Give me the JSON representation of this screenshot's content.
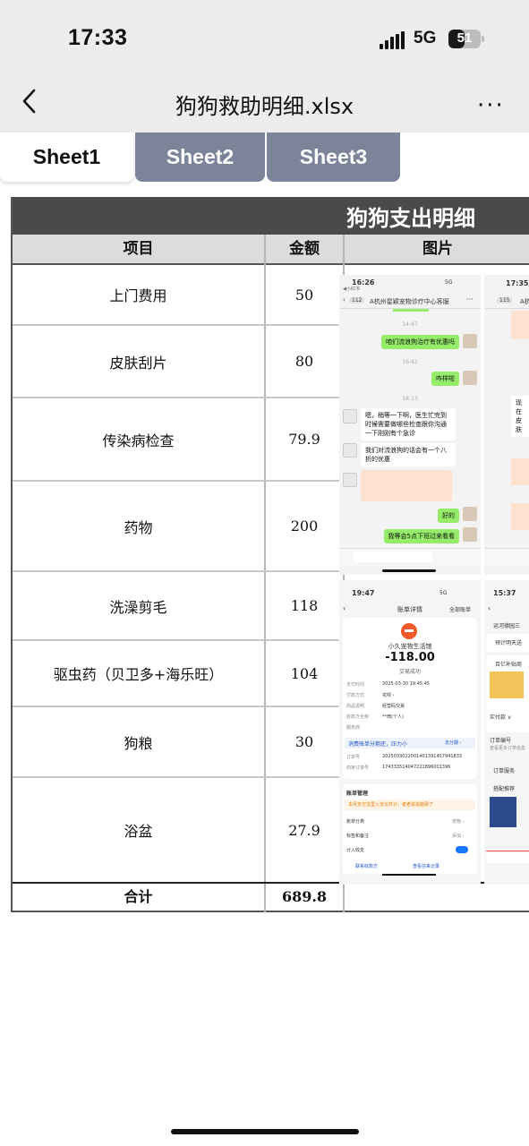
{
  "status": {
    "time": "17:33",
    "network": "5G",
    "battery": "51",
    "battery_level": 0.51
  },
  "nav": {
    "title": "狗狗救助明细.xlsx",
    "more": "···"
  },
  "tabs": [
    {
      "label": "Sheet1",
      "active": true
    },
    {
      "label": "Sheet2",
      "active": false
    },
    {
      "label": "Sheet3",
      "active": false
    }
  ],
  "sheet": {
    "title": "狗狗支出明细",
    "headers": {
      "item": "项目",
      "amount": "金额",
      "image": "图片"
    },
    "rows": [
      {
        "item": "上门费用",
        "amount": "50"
      },
      {
        "item": "皮肤刮片",
        "amount": "80"
      },
      {
        "item": "传染病检查",
        "amount": "79.9"
      },
      {
        "item": "药物",
        "amount": "200"
      },
      {
        "item": "洗澡剪毛",
        "amount": "118"
      },
      {
        "item": "驱虫药（贝卫多+海乐旺）",
        "amount": "104"
      },
      {
        "item": "狗粮",
        "amount": "30"
      },
      {
        "item": "浴盆",
        "amount": "27.9"
      }
    ],
    "total": {
      "label": "合计",
      "amount": "689.8"
    }
  },
  "chat_shot": {
    "time": "16:26",
    "net": "5G",
    "back_label": "◀小红书",
    "unread": "112",
    "contact": "A杭州星颖宠物诊疗中心客服",
    "ts1": "14:47",
    "msg1": "咱们流浪狗治疗有优惠吗",
    "ts2": "16:42",
    "msg2": "咋样啦",
    "ts3": "18:13",
    "msg3": "嗯，稍等一下啊，医生忙完到时候需要做哪些检查跟你沟通一下刚刚有个急诊",
    "msg4": "我们对流浪狗的话会有一个八折的优惠",
    "msg5": "好的",
    "msg6": "我等会5点下班过来看看"
  },
  "chat_shot2": {
    "time": "17:35",
    "unread": "115",
    "contact": "A杭",
    "msg": "现在 皮肤"
  },
  "bill_shot": {
    "time": "19:47",
    "net": "5G",
    "title": "账单详情",
    "all": "全部账单",
    "merchant": "小久宠物生活馆",
    "amount": "-118.00",
    "status": "交易成功",
    "rows": [
      {
        "k": "支付时间",
        "v": "2025-03-30 19:45:45"
      },
      {
        "k": "付款方式",
        "v": "花呗 ›"
      },
      {
        "k": "商品说明",
        "v": "经营码交易"
      },
      {
        "k": "收款方全称",
        "v": "**琦(个人)"
      },
      {
        "k": "服务商",
        "v": ""
      }
    ],
    "promo": "消费账单分期还，压力小",
    "promo_link": "去分期 ›",
    "order_k": "订单号",
    "order_v": "2025033022001401391457941833",
    "merchant_order_k": "商家订单号",
    "merchant_order_v": "1743335140472218960013​96",
    "manage": "账单管理",
    "notice": "本月支付宝里入支出共计，者者说说能顾了",
    "cat_k": "账单分类",
    "cat_v": "宠物 ›",
    "note_k": "标签和备注",
    "note_v": "添加 ›",
    "count_k": "计入收支",
    "footer1": "联系收款方",
    "footer2": "查看往来记录"
  },
  "order_shot": {
    "time": "15:37",
    "store": "运河德园三",
    "eta": "预计明天送",
    "sub": "百亿补贴商",
    "pay": "实付款 ∨",
    "order": "订单编号",
    "more": "查看更多订单信息",
    "service": "订单服务",
    "recommend": "搭配推荐"
  }
}
